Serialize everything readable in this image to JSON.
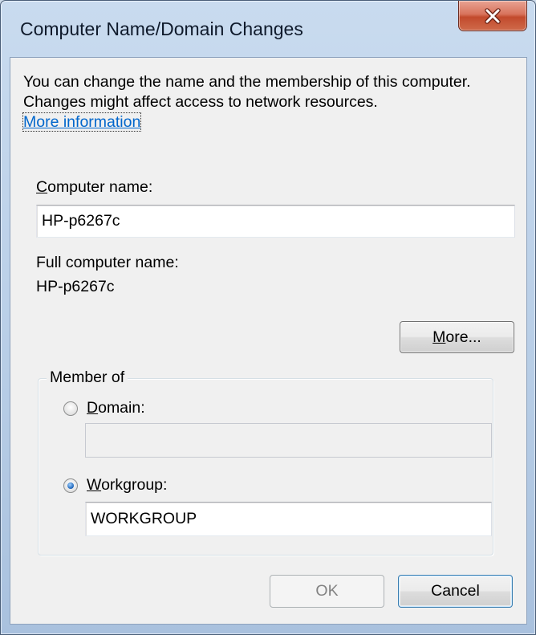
{
  "window": {
    "title": "Computer Name/Domain Changes",
    "close_icon": "close-icon"
  },
  "description": {
    "text": "You can change the name and the membership of this computer. Changes might affect access to network resources.",
    "link": "More information"
  },
  "computer_name": {
    "label_accel": "C",
    "label_rest": "omputer name:",
    "value": "HP-p6267c"
  },
  "full_name": {
    "label": "Full computer name:",
    "value": "HP-p6267c"
  },
  "more_button": {
    "accel": "M",
    "rest": "ore..."
  },
  "member_of": {
    "legend": "Member of",
    "domain": {
      "label_accel": "D",
      "label_rest": "omain:",
      "value": "",
      "selected": false
    },
    "workgroup": {
      "label_accel": "W",
      "label_rest": "orkgroup:",
      "value": "WORKGROUP",
      "selected": true
    }
  },
  "buttons": {
    "ok": "OK",
    "cancel": "Cancel"
  }
}
